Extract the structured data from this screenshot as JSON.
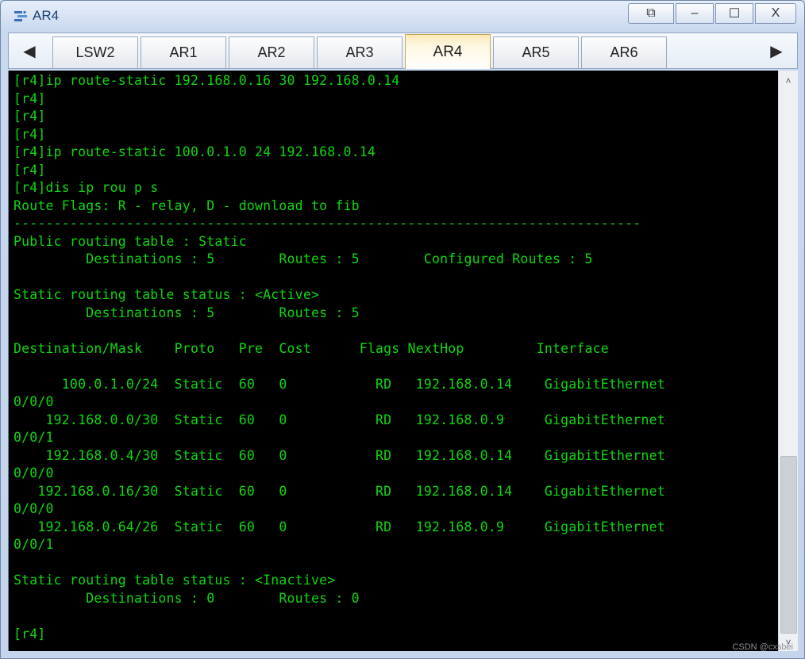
{
  "window": {
    "title": "AR4",
    "buttons": {
      "restore": "⧉",
      "minimize": "–",
      "maximize": "☐",
      "close": "X"
    }
  },
  "tabs": {
    "scroll_left": "◀",
    "scroll_right": "▶",
    "items": [
      {
        "label": "LSW2"
      },
      {
        "label": "AR1"
      },
      {
        "label": "AR2"
      },
      {
        "label": "AR3"
      },
      {
        "label": "AR4"
      },
      {
        "label": "AR5"
      },
      {
        "label": "AR6"
      }
    ],
    "active_index": 4
  },
  "terminal": {
    "text_color": "#10d610",
    "lines": [
      "[r4]ip route-static 192.168.0.16 30 192.168.0.14",
      "[r4]",
      "[r4]",
      "[r4]",
      "[r4]ip route-static 100.0.1.0 24 192.168.0.14",
      "[r4]",
      "[r4]dis ip rou p s",
      "Route Flags: R - relay, D - download to fib",
      "------------------------------------------------------------------------------",
      "Public routing table : Static",
      "         Destinations : 5        Routes : 5        Configured Routes : 5",
      "",
      "Static routing table status : <Active>",
      "         Destinations : 5        Routes : 5",
      "",
      "Destination/Mask    Proto   Pre  Cost      Flags NextHop         Interface",
      "",
      "      100.0.1.0/24  Static  60   0           RD   192.168.0.14    GigabitEthernet",
      "0/0/0",
      "    192.168.0.0/30  Static  60   0           RD   192.168.0.9     GigabitEthernet",
      "0/0/1",
      "    192.168.0.4/30  Static  60   0           RD   192.168.0.14    GigabitEthernet",
      "0/0/0",
      "   192.168.0.16/30  Static  60   0           RD   192.168.0.14    GigabitEthernet",
      "0/0/0",
      "   192.168.0.64/26  Static  60   0           RD   192.168.0.9     GigabitEthernet",
      "0/0/1",
      "",
      "Static routing table status : <Inactive>",
      "         Destinations : 0        Routes : 0",
      "",
      "[r4]"
    ]
  },
  "scrollbar": {
    "up": "˄",
    "down": "˅"
  },
  "watermark": "CSDN @cxsbei"
}
